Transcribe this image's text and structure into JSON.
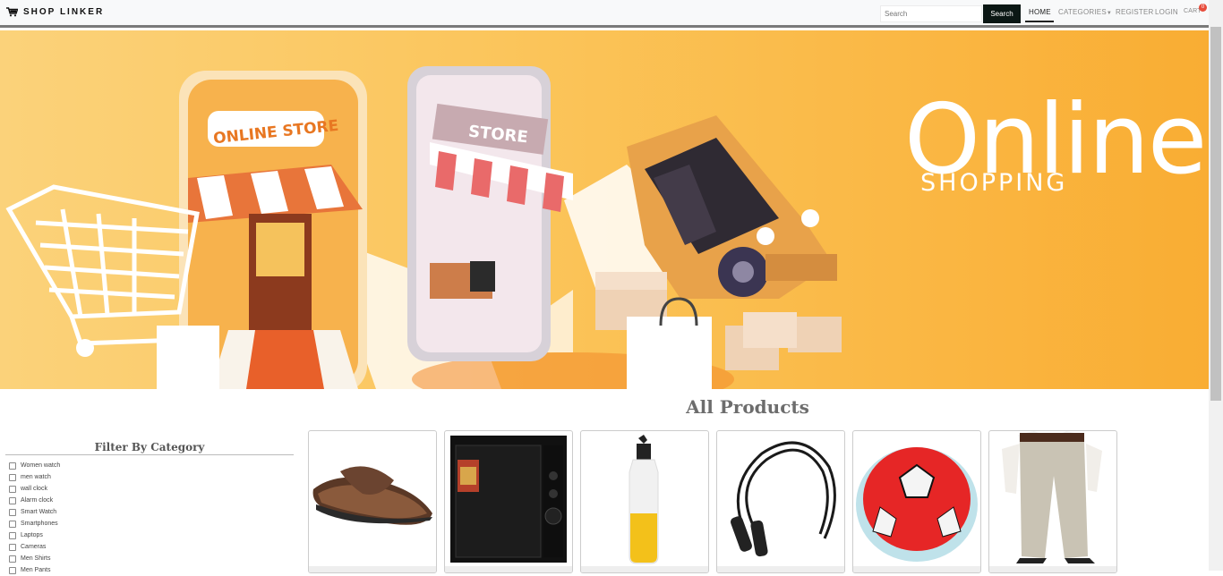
{
  "navbar": {
    "brand": "SHOP LINKER",
    "search_placeholder": "Search",
    "search_button": "Search",
    "links": {
      "home": "HOME",
      "categories": "CATEGORIES",
      "register": "REGISTER",
      "login": "LOGIN",
      "cart": "CART"
    },
    "cart_count": "0"
  },
  "banner": {
    "headline": "Online.",
    "subheadline": "SHOPPING",
    "store_sign": "ONLINE STORE",
    "phone_sign": "STORE"
  },
  "main": {
    "title": "All Products"
  },
  "filter": {
    "title": "Filter By Category",
    "categories": [
      "Women watch",
      "men watch",
      "wall clock",
      "Alarm clock",
      "Smart Watch",
      "Smartphones",
      "Laptops",
      "Cameras",
      "Men Shirts",
      "Men Pants"
    ]
  },
  "products": [
    {
      "image": "sandal"
    },
    {
      "image": "microwave"
    },
    {
      "image": "oil-bottle"
    },
    {
      "image": "jump-rope"
    },
    {
      "image": "hover-ball"
    },
    {
      "image": "trousers"
    }
  ],
  "colors": {
    "banner_start": "#fbd27a",
    "banner_end": "#f9ad33",
    "accent": "#e87722",
    "button": "#0b1714",
    "badge": "#e74c3c"
  }
}
